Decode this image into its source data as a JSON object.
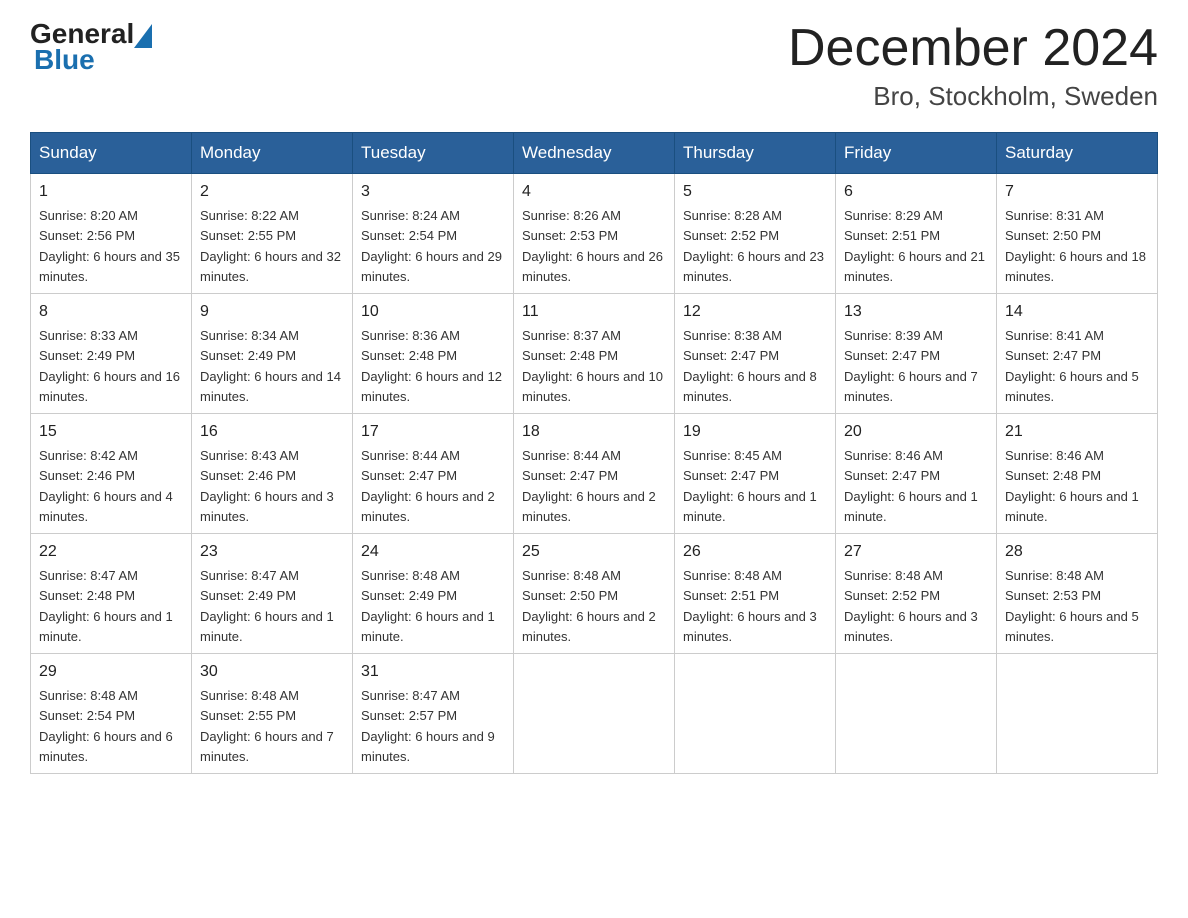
{
  "header": {
    "logo_general": "General",
    "logo_blue": "Blue",
    "title": "December 2024",
    "subtitle": "Bro, Stockholm, Sweden"
  },
  "calendar": {
    "days_of_week": [
      "Sunday",
      "Monday",
      "Tuesday",
      "Wednesday",
      "Thursday",
      "Friday",
      "Saturday"
    ],
    "weeks": [
      [
        {
          "day": "1",
          "sunrise": "8:20 AM",
          "sunset": "2:56 PM",
          "daylight": "6 hours and 35 minutes."
        },
        {
          "day": "2",
          "sunrise": "8:22 AM",
          "sunset": "2:55 PM",
          "daylight": "6 hours and 32 minutes."
        },
        {
          "day": "3",
          "sunrise": "8:24 AM",
          "sunset": "2:54 PM",
          "daylight": "6 hours and 29 minutes."
        },
        {
          "day": "4",
          "sunrise": "8:26 AM",
          "sunset": "2:53 PM",
          "daylight": "6 hours and 26 minutes."
        },
        {
          "day": "5",
          "sunrise": "8:28 AM",
          "sunset": "2:52 PM",
          "daylight": "6 hours and 23 minutes."
        },
        {
          "day": "6",
          "sunrise": "8:29 AM",
          "sunset": "2:51 PM",
          "daylight": "6 hours and 21 minutes."
        },
        {
          "day": "7",
          "sunrise": "8:31 AM",
          "sunset": "2:50 PM",
          "daylight": "6 hours and 18 minutes."
        }
      ],
      [
        {
          "day": "8",
          "sunrise": "8:33 AM",
          "sunset": "2:49 PM",
          "daylight": "6 hours and 16 minutes."
        },
        {
          "day": "9",
          "sunrise": "8:34 AM",
          "sunset": "2:49 PM",
          "daylight": "6 hours and 14 minutes."
        },
        {
          "day": "10",
          "sunrise": "8:36 AM",
          "sunset": "2:48 PM",
          "daylight": "6 hours and 12 minutes."
        },
        {
          "day": "11",
          "sunrise": "8:37 AM",
          "sunset": "2:48 PM",
          "daylight": "6 hours and 10 minutes."
        },
        {
          "day": "12",
          "sunrise": "8:38 AM",
          "sunset": "2:47 PM",
          "daylight": "6 hours and 8 minutes."
        },
        {
          "day": "13",
          "sunrise": "8:39 AM",
          "sunset": "2:47 PM",
          "daylight": "6 hours and 7 minutes."
        },
        {
          "day": "14",
          "sunrise": "8:41 AM",
          "sunset": "2:47 PM",
          "daylight": "6 hours and 5 minutes."
        }
      ],
      [
        {
          "day": "15",
          "sunrise": "8:42 AM",
          "sunset": "2:46 PM",
          "daylight": "6 hours and 4 minutes."
        },
        {
          "day": "16",
          "sunrise": "8:43 AM",
          "sunset": "2:46 PM",
          "daylight": "6 hours and 3 minutes."
        },
        {
          "day": "17",
          "sunrise": "8:44 AM",
          "sunset": "2:47 PM",
          "daylight": "6 hours and 2 minutes."
        },
        {
          "day": "18",
          "sunrise": "8:44 AM",
          "sunset": "2:47 PM",
          "daylight": "6 hours and 2 minutes."
        },
        {
          "day": "19",
          "sunrise": "8:45 AM",
          "sunset": "2:47 PM",
          "daylight": "6 hours and 1 minute."
        },
        {
          "day": "20",
          "sunrise": "8:46 AM",
          "sunset": "2:47 PM",
          "daylight": "6 hours and 1 minute."
        },
        {
          "day": "21",
          "sunrise": "8:46 AM",
          "sunset": "2:48 PM",
          "daylight": "6 hours and 1 minute."
        }
      ],
      [
        {
          "day": "22",
          "sunrise": "8:47 AM",
          "sunset": "2:48 PM",
          "daylight": "6 hours and 1 minute."
        },
        {
          "day": "23",
          "sunrise": "8:47 AM",
          "sunset": "2:49 PM",
          "daylight": "6 hours and 1 minute."
        },
        {
          "day": "24",
          "sunrise": "8:48 AM",
          "sunset": "2:49 PM",
          "daylight": "6 hours and 1 minute."
        },
        {
          "day": "25",
          "sunrise": "8:48 AM",
          "sunset": "2:50 PM",
          "daylight": "6 hours and 2 minutes."
        },
        {
          "day": "26",
          "sunrise": "8:48 AM",
          "sunset": "2:51 PM",
          "daylight": "6 hours and 3 minutes."
        },
        {
          "day": "27",
          "sunrise": "8:48 AM",
          "sunset": "2:52 PM",
          "daylight": "6 hours and 3 minutes."
        },
        {
          "day": "28",
          "sunrise": "8:48 AM",
          "sunset": "2:53 PM",
          "daylight": "6 hours and 5 minutes."
        }
      ],
      [
        {
          "day": "29",
          "sunrise": "8:48 AM",
          "sunset": "2:54 PM",
          "daylight": "6 hours and 6 minutes."
        },
        {
          "day": "30",
          "sunrise": "8:48 AM",
          "sunset": "2:55 PM",
          "daylight": "6 hours and 7 minutes."
        },
        {
          "day": "31",
          "sunrise": "8:47 AM",
          "sunset": "2:57 PM",
          "daylight": "6 hours and 9 minutes."
        },
        null,
        null,
        null,
        null
      ]
    ],
    "labels": {
      "sunrise": "Sunrise:",
      "sunset": "Sunset:",
      "daylight": "Daylight:"
    }
  }
}
